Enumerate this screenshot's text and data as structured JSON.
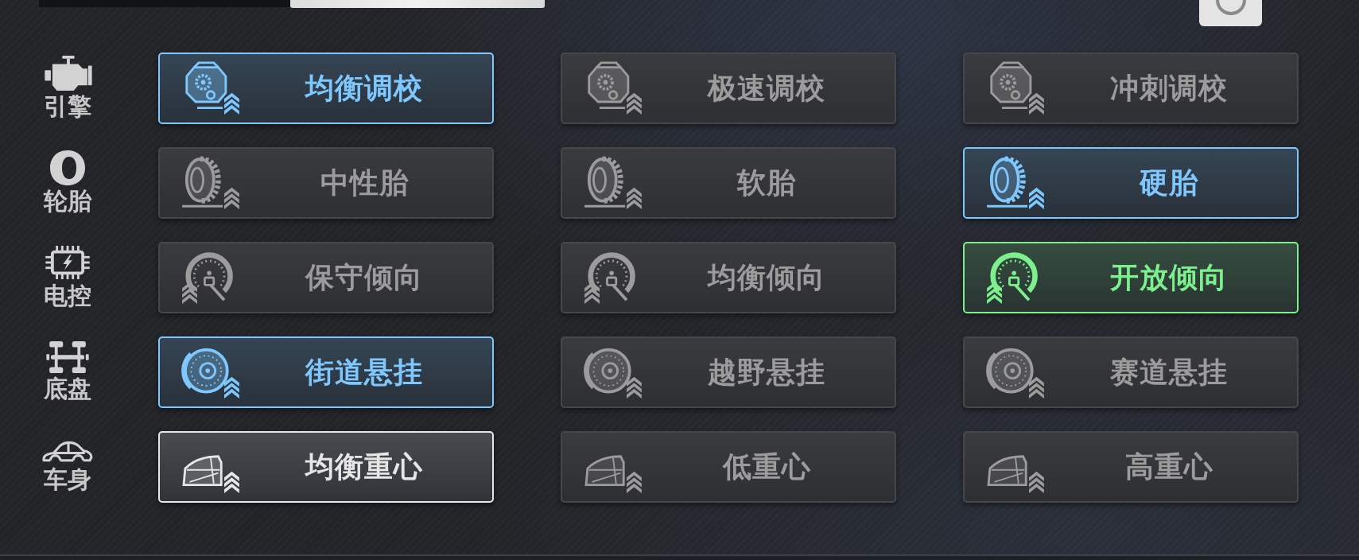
{
  "sections": [
    {
      "kind": "engine",
      "label": "引擎",
      "options": [
        {
          "label": "均衡调校",
          "selected": true,
          "color": "#7ec8ff"
        },
        {
          "label": "极速调校",
          "selected": false
        },
        {
          "label": "冲刺调校",
          "selected": false
        }
      ]
    },
    {
      "kind": "tire",
      "label": "轮胎",
      "options": [
        {
          "label": "中性胎",
          "selected": false
        },
        {
          "label": "软胎",
          "selected": false
        },
        {
          "label": "硬胎",
          "selected": true,
          "color": "#7ec8ff"
        }
      ]
    },
    {
      "kind": "ecu",
      "label": "电控",
      "options": [
        {
          "label": "保守倾向",
          "selected": false
        },
        {
          "label": "均衡倾向",
          "selected": false
        },
        {
          "label": "开放倾向",
          "selected": true,
          "color": "#7cf08c"
        }
      ]
    },
    {
      "kind": "chassis",
      "label": "底盘",
      "options": [
        {
          "label": "街道悬挂",
          "selected": true,
          "color": "#7ec8ff"
        },
        {
          "label": "越野悬挂",
          "selected": false
        },
        {
          "label": "赛道悬挂",
          "selected": false
        }
      ]
    },
    {
      "kind": "body",
      "label": "车身",
      "options": [
        {
          "label": "均衡重心",
          "selected": true,
          "color": "#e6e6e6"
        },
        {
          "label": "低重心",
          "selected": false
        },
        {
          "label": "高重心",
          "selected": false
        }
      ]
    }
  ]
}
